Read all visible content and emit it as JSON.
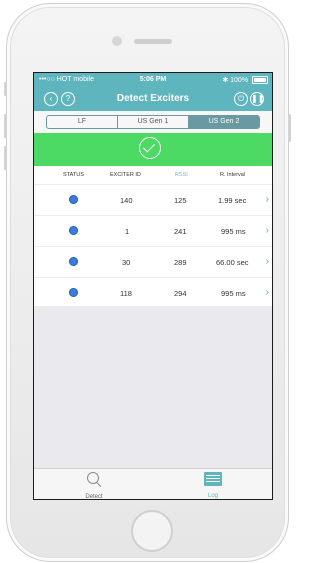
{
  "status_bar": {
    "carrier": "•••○○ HOT mobile",
    "time": "5:06 PM",
    "battery": "100%"
  },
  "nav": {
    "title": "Detect Exciters",
    "back_icon": "back-icon",
    "help_icon": "help-icon",
    "power_icon": "power-icon",
    "pause_icon": "pause-icon"
  },
  "segments": [
    "LF",
    "US Gen 1",
    "US Gen 2"
  ],
  "selected_segment": "US Gen 2",
  "banner": {
    "icon": "checkmark-icon",
    "color": "#4cd964"
  },
  "table": {
    "columns": [
      "STATUS",
      "EXCITER ID",
      "RSSI",
      "R. Interval"
    ],
    "rows": [
      {
        "exciter_id": "140",
        "rssi": "125",
        "interval": "1.99 sec"
      },
      {
        "exciter_id": "1",
        "rssi": "241",
        "interval": "995 ms"
      },
      {
        "exciter_id": "30",
        "rssi": "289",
        "interval": "66.00 sec"
      },
      {
        "exciter_id": "118",
        "rssi": "294",
        "interval": "995 ms"
      }
    ]
  },
  "tabs": {
    "detect": "Detect",
    "log": "Log"
  },
  "colors": {
    "accent": "#5fb5bd",
    "status_dot": "#3b7be0",
    "success": "#4cd964"
  }
}
